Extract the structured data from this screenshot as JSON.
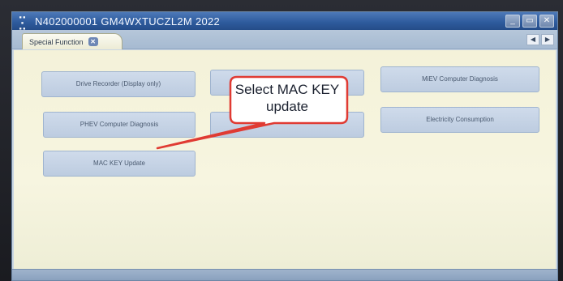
{
  "window": {
    "title": "N402000001  GM4WXTUCZL2M 2022",
    "logo_text": "▪▪ ▪ ▪▪",
    "controls": {
      "minimize": "_",
      "restore": "▭",
      "close": "✕"
    }
  },
  "tabs": [
    {
      "label": "Special Function",
      "close_symbol": "✕",
      "active": true
    }
  ],
  "tab_nav": {
    "prev": "◀",
    "next": "▶"
  },
  "functions": [
    {
      "label": "Drive Recorder (Display only)"
    },
    {
      "label": ""
    },
    {
      "label": "MiEV Computer Diagnosis"
    },
    {
      "label": "PHEV Computer Diagnosis"
    },
    {
      "label": ""
    },
    {
      "label": "Electricity Consumption"
    },
    {
      "label": "MAC KEY Update"
    }
  ],
  "annotation": {
    "text": "Select MAC KEY update",
    "color": "#e03b33"
  }
}
